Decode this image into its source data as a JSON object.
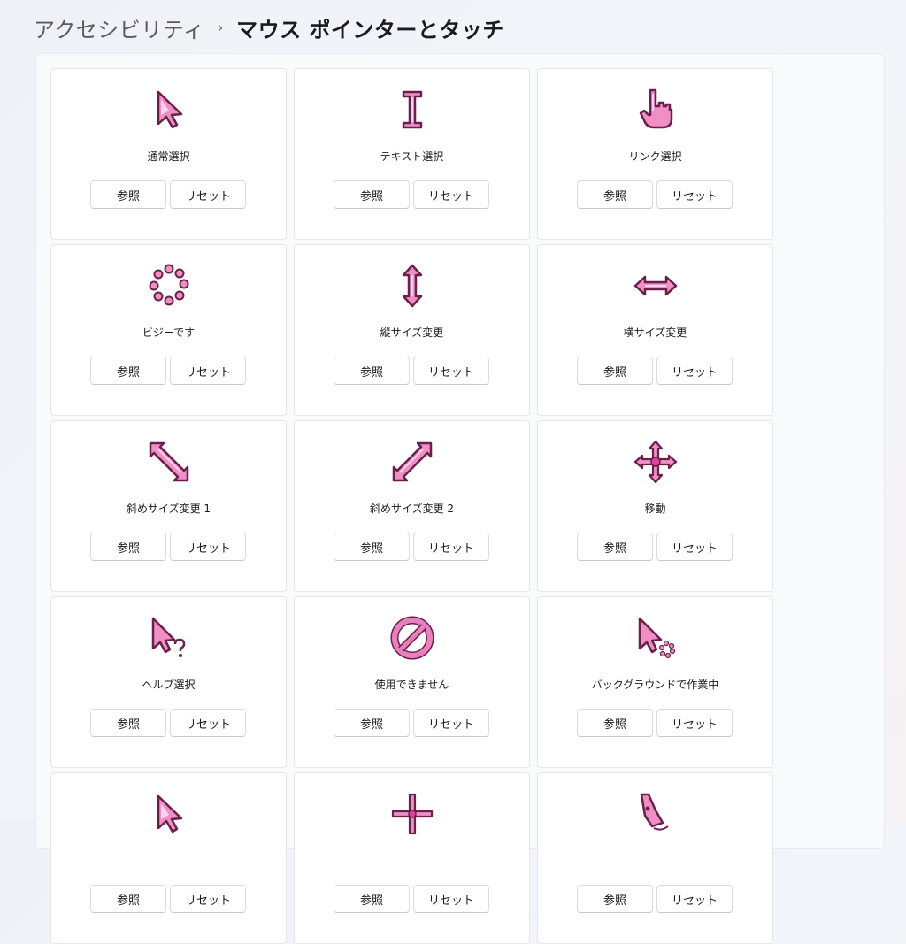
{
  "breadcrumb": {
    "parent": "アクセシビリティ",
    "separator": "›",
    "current": "マウス ポインターとタッチ"
  },
  "buttons": {
    "browse": "参照",
    "reset": "リセット"
  },
  "cards": [
    {
      "label": "通常選択",
      "icon": "normal-select-cursor-icon"
    },
    {
      "label": "テキスト選択",
      "icon": "text-select-cursor-icon"
    },
    {
      "label": "リンク選択",
      "icon": "link-select-cursor-icon"
    },
    {
      "label": "ビジーです",
      "icon": "busy-cursor-icon"
    },
    {
      "label": "縦サイズ変更",
      "icon": "vertical-resize-cursor-icon"
    },
    {
      "label": "横サイズ変更",
      "icon": "horizontal-resize-cursor-icon"
    },
    {
      "label": "斜めサイズ変更 1",
      "icon": "diagonal-resize-1-cursor-icon"
    },
    {
      "label": "斜めサイズ変更 2",
      "icon": "diagonal-resize-2-cursor-icon"
    },
    {
      "label": "移動",
      "icon": "move-cursor-icon"
    },
    {
      "label": "ヘルプ選択",
      "icon": "help-select-cursor-icon"
    },
    {
      "label": "使用できません",
      "icon": "unavailable-cursor-icon"
    },
    {
      "label": "バックグラウンドで作業中",
      "icon": "working-in-background-cursor-icon"
    },
    {
      "label": "",
      "icon": "alternate-select-cursor-icon"
    },
    {
      "label": "",
      "icon": "precision-select-cursor-icon"
    },
    {
      "label": "",
      "icon": "handwriting-cursor-icon"
    }
  ],
  "colors": {
    "accent_pink": "#e55fa8",
    "dark_outline": "#6a1f4d",
    "light_pink": "#f6b3d8"
  }
}
